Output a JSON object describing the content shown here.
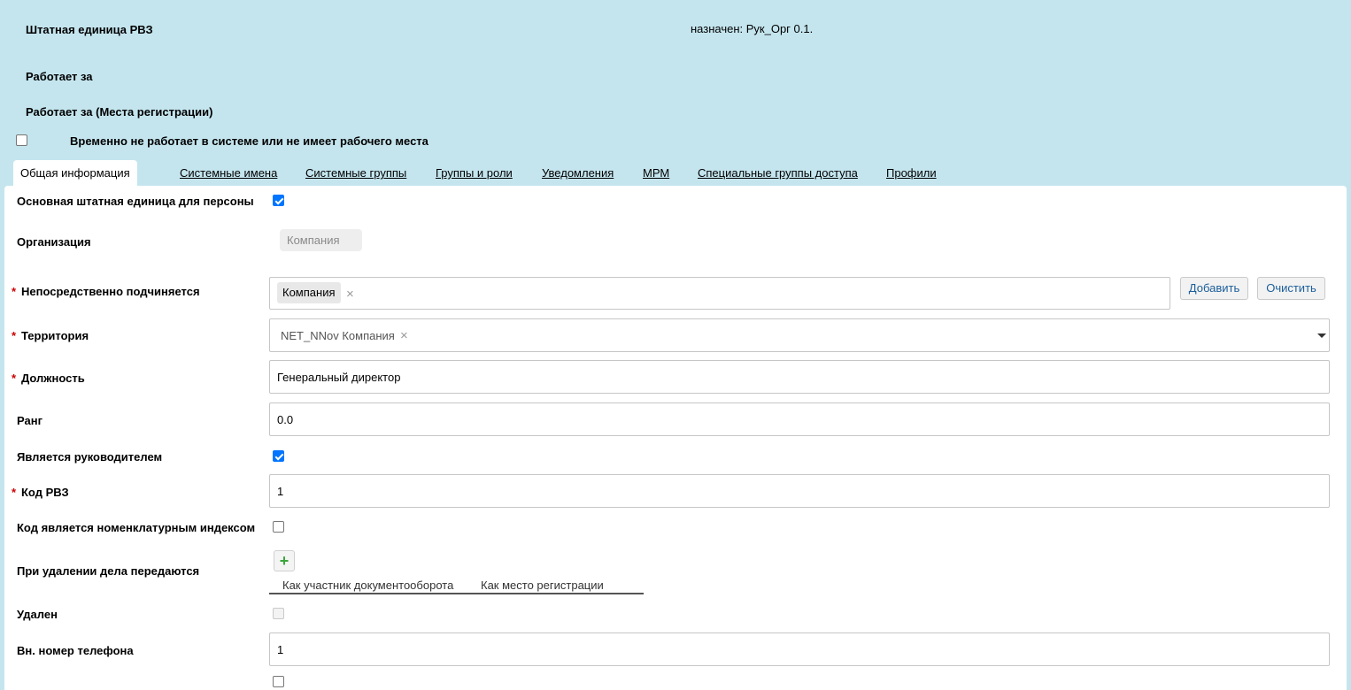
{
  "header": {
    "staff_unit_label": "Штатная единица РВЗ",
    "assigned_text": "назначен: Рук_Орг 0.1.",
    "works_for_label": "Работает за",
    "works_for_reg_label": "Работает за (Места регистрации)",
    "temp_not_working_label": "Временно не работает в системе или не имеет рабочего места"
  },
  "tabs": [
    {
      "label": "Общая информация"
    },
    {
      "label": "Системные имена"
    },
    {
      "label": "Системные группы"
    },
    {
      "label": "Группы и роли"
    },
    {
      "label": "Уведомления"
    },
    {
      "label": "МРМ"
    },
    {
      "label": "Специальные группы доступа"
    },
    {
      "label": "Профили"
    }
  ],
  "form": {
    "main_unit_label": "Основная штатная единица для персоны",
    "organization_label": "Организация",
    "organization_value": "Компания",
    "reports_to_label": "Непосредственно подчиняется",
    "reports_to_tag": "Компания",
    "add_button": "Добавить",
    "clear_button": "Очистить",
    "territory_label": "Территория",
    "territory_tag": "NET_NNov Компания",
    "position_label": "Должность",
    "position_value": "Генеральный директор",
    "rank_label": "Ранг",
    "rank_value": "0.0",
    "is_manager_label": "Является руководителем",
    "code_label": "Код РВЗ",
    "code_value": "1",
    "code_index_label": "Код является номенклатурным индексом",
    "on_delete_label": "При удалении дела передаются",
    "subtab_participant": "Как участник документооборота",
    "subtab_registration": "Как место регистрации",
    "deleted_label": "Удален",
    "phone_label": "Вн. номер телефона",
    "phone_value": "1",
    "required_mark": "*"
  },
  "icons": {
    "close": "×",
    "plus": "+"
  }
}
